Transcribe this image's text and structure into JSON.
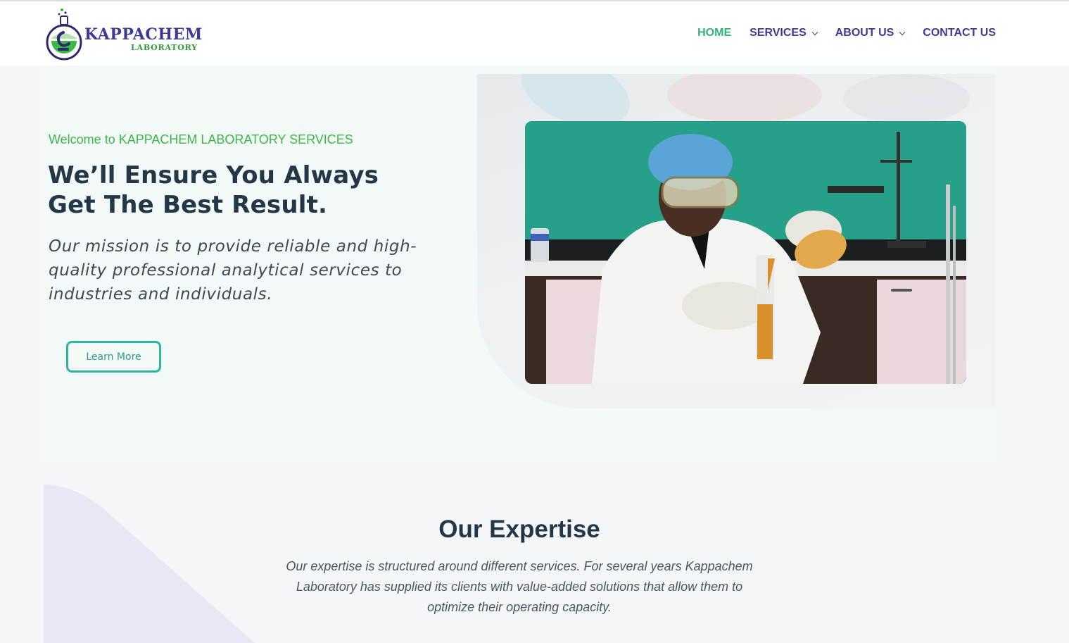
{
  "brand": {
    "name": "KAPPACHEM",
    "subname": "LABORATORY",
    "colors": {
      "primary": "#3d3a94",
      "accent_green": "#3cb847",
      "teal": "#2fb59a",
      "heading": "#243746"
    }
  },
  "nav": {
    "items": [
      {
        "label": "HOME",
        "active": true,
        "dropdown": false
      },
      {
        "label": "SERVICES",
        "active": false,
        "dropdown": true
      },
      {
        "label": "ABOUT US",
        "active": false,
        "dropdown": true
      },
      {
        "label": "CONTACT US",
        "active": false,
        "dropdown": false
      }
    ]
  },
  "hero": {
    "eyebrow": "Welcome to KAPPACHEM LABORATORY SERVICES",
    "headline_line1": "We’ll Ensure You Always",
    "headline_line2": "Get The Best Result.",
    "mission": "Our mission is to provide reliable and high-quality professional analytical services to industries and individuals.",
    "cta_label": "Learn More",
    "image_icon": "lab-technician-photo"
  },
  "expertise": {
    "title": "Our Expertise",
    "description": "Our expertise is structured around different services. For several years Kappachem Laboratory has supplied its clients with value-added solutions that allow them to optimize their operating capacity."
  }
}
